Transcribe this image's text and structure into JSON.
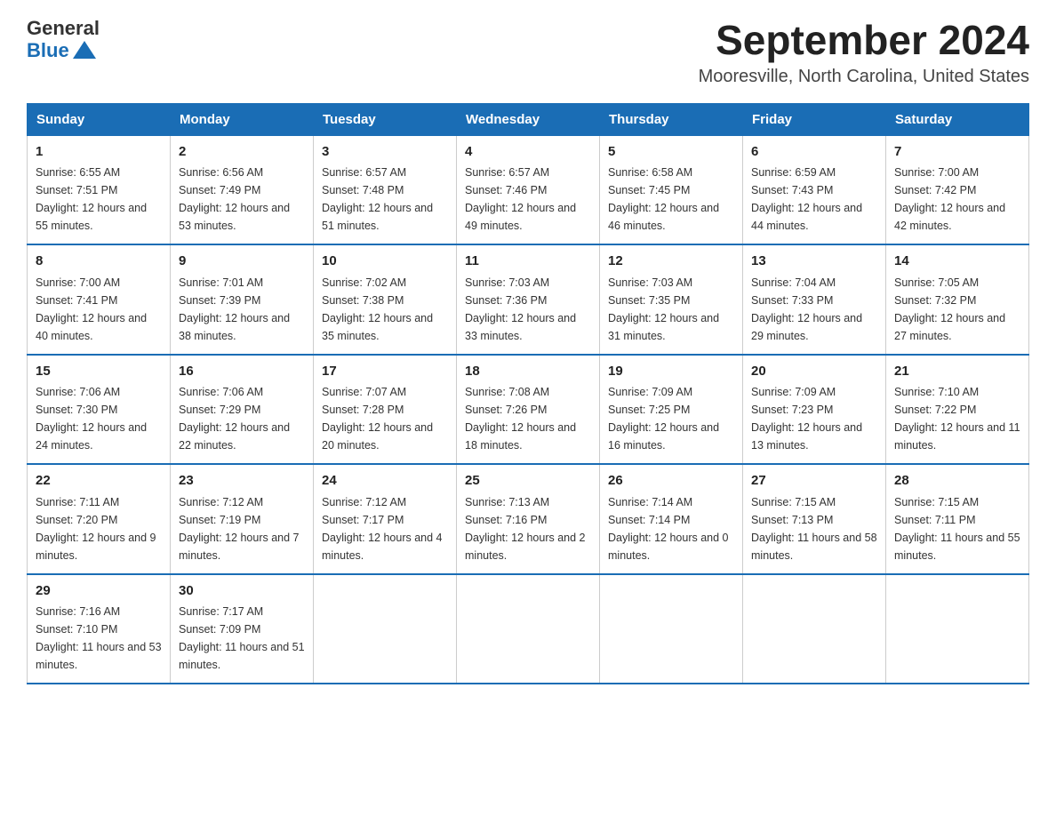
{
  "header": {
    "logo": {
      "general": "General",
      "blue": "Blue"
    },
    "title": "September 2024",
    "location": "Mooresville, North Carolina, United States"
  },
  "calendar": {
    "weekdays": [
      "Sunday",
      "Monday",
      "Tuesday",
      "Wednesday",
      "Thursday",
      "Friday",
      "Saturday"
    ],
    "weeks": [
      [
        {
          "day": "1",
          "sunrise": "6:55 AM",
          "sunset": "7:51 PM",
          "daylight": "12 hours and 55 minutes."
        },
        {
          "day": "2",
          "sunrise": "6:56 AM",
          "sunset": "7:49 PM",
          "daylight": "12 hours and 53 minutes."
        },
        {
          "day": "3",
          "sunrise": "6:57 AM",
          "sunset": "7:48 PM",
          "daylight": "12 hours and 51 minutes."
        },
        {
          "day": "4",
          "sunrise": "6:57 AM",
          "sunset": "7:46 PM",
          "daylight": "12 hours and 49 minutes."
        },
        {
          "day": "5",
          "sunrise": "6:58 AM",
          "sunset": "7:45 PM",
          "daylight": "12 hours and 46 minutes."
        },
        {
          "day": "6",
          "sunrise": "6:59 AM",
          "sunset": "7:43 PM",
          "daylight": "12 hours and 44 minutes."
        },
        {
          "day": "7",
          "sunrise": "7:00 AM",
          "sunset": "7:42 PM",
          "daylight": "12 hours and 42 minutes."
        }
      ],
      [
        {
          "day": "8",
          "sunrise": "7:00 AM",
          "sunset": "7:41 PM",
          "daylight": "12 hours and 40 minutes."
        },
        {
          "day": "9",
          "sunrise": "7:01 AM",
          "sunset": "7:39 PM",
          "daylight": "12 hours and 38 minutes."
        },
        {
          "day": "10",
          "sunrise": "7:02 AM",
          "sunset": "7:38 PM",
          "daylight": "12 hours and 35 minutes."
        },
        {
          "day": "11",
          "sunrise": "7:03 AM",
          "sunset": "7:36 PM",
          "daylight": "12 hours and 33 minutes."
        },
        {
          "day": "12",
          "sunrise": "7:03 AM",
          "sunset": "7:35 PM",
          "daylight": "12 hours and 31 minutes."
        },
        {
          "day": "13",
          "sunrise": "7:04 AM",
          "sunset": "7:33 PM",
          "daylight": "12 hours and 29 minutes."
        },
        {
          "day": "14",
          "sunrise": "7:05 AM",
          "sunset": "7:32 PM",
          "daylight": "12 hours and 27 minutes."
        }
      ],
      [
        {
          "day": "15",
          "sunrise": "7:06 AM",
          "sunset": "7:30 PM",
          "daylight": "12 hours and 24 minutes."
        },
        {
          "day": "16",
          "sunrise": "7:06 AM",
          "sunset": "7:29 PM",
          "daylight": "12 hours and 22 minutes."
        },
        {
          "day": "17",
          "sunrise": "7:07 AM",
          "sunset": "7:28 PM",
          "daylight": "12 hours and 20 minutes."
        },
        {
          "day": "18",
          "sunrise": "7:08 AM",
          "sunset": "7:26 PM",
          "daylight": "12 hours and 18 minutes."
        },
        {
          "day": "19",
          "sunrise": "7:09 AM",
          "sunset": "7:25 PM",
          "daylight": "12 hours and 16 minutes."
        },
        {
          "day": "20",
          "sunrise": "7:09 AM",
          "sunset": "7:23 PM",
          "daylight": "12 hours and 13 minutes."
        },
        {
          "day": "21",
          "sunrise": "7:10 AM",
          "sunset": "7:22 PM",
          "daylight": "12 hours and 11 minutes."
        }
      ],
      [
        {
          "day": "22",
          "sunrise": "7:11 AM",
          "sunset": "7:20 PM",
          "daylight": "12 hours and 9 minutes."
        },
        {
          "day": "23",
          "sunrise": "7:12 AM",
          "sunset": "7:19 PM",
          "daylight": "12 hours and 7 minutes."
        },
        {
          "day": "24",
          "sunrise": "7:12 AM",
          "sunset": "7:17 PM",
          "daylight": "12 hours and 4 minutes."
        },
        {
          "day": "25",
          "sunrise": "7:13 AM",
          "sunset": "7:16 PM",
          "daylight": "12 hours and 2 minutes."
        },
        {
          "day": "26",
          "sunrise": "7:14 AM",
          "sunset": "7:14 PM",
          "daylight": "12 hours and 0 minutes."
        },
        {
          "day": "27",
          "sunrise": "7:15 AM",
          "sunset": "7:13 PM",
          "daylight": "11 hours and 58 minutes."
        },
        {
          "day": "28",
          "sunrise": "7:15 AM",
          "sunset": "7:11 PM",
          "daylight": "11 hours and 55 minutes."
        }
      ],
      [
        {
          "day": "29",
          "sunrise": "7:16 AM",
          "sunset": "7:10 PM",
          "daylight": "11 hours and 53 minutes."
        },
        {
          "day": "30",
          "sunrise": "7:17 AM",
          "sunset": "7:09 PM",
          "daylight": "11 hours and 51 minutes."
        },
        null,
        null,
        null,
        null,
        null
      ]
    ]
  }
}
